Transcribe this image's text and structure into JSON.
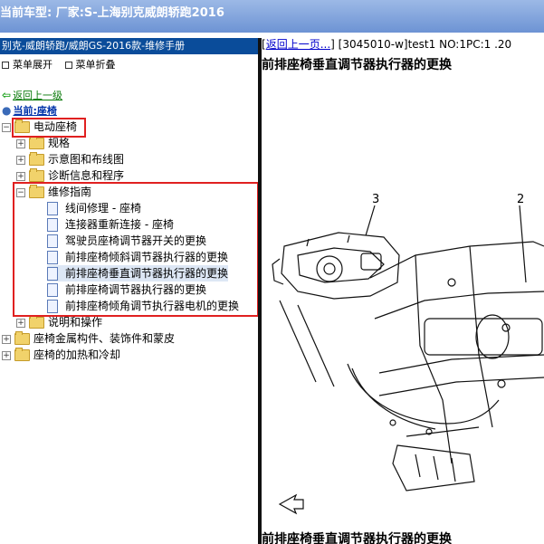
{
  "titlebar": {
    "text": "当前车型:  厂家:S-上海别克威朗轿跑2016"
  },
  "left_panel": {
    "header": "别克-威朗轿跑/威朗GS-2016款-维修手册",
    "expand_menu": "菜单展开",
    "collapse_menu": "菜单折叠",
    "back_link": "返回上一级",
    "current_label": "当前:座椅"
  },
  "tree": {
    "root": "电动座椅",
    "children": [
      {
        "label": "规格"
      },
      {
        "label": "示意图和布线图"
      },
      {
        "label": "诊断信息和程序"
      },
      {
        "label": "维修指南"
      }
    ],
    "repair_items": [
      "线间修理 - 座椅",
      "连接器重新连接 - 座椅",
      "驾驶员座椅调节器开关的更换",
      "前排座椅倾斜调节器执行器的更换",
      "前排座椅垂直调节器执行器的更换",
      "前排座椅调节器执行器的更换",
      "前排座椅倾角调节执行器电机的更换"
    ],
    "after": "说明和操作",
    "others": [
      "座椅金属构件、装饰件和蒙皮",
      "座椅的加热和冷却"
    ]
  },
  "content": {
    "back": "返回上一页...",
    "doc_ref": "[3045010-w]test1 NO:1PC:1 .20",
    "heading": "前排座椅垂直调节器执行器的更换",
    "callout_3": "3",
    "callout_2": "2",
    "footer_heading": "前排座椅垂直调节器执行器的更换"
  },
  "colors": {
    "title_bar": "#7da0dc",
    "left_header": "#0a4c9a",
    "highlight_box": "#e02020",
    "link": "#0000cc"
  }
}
